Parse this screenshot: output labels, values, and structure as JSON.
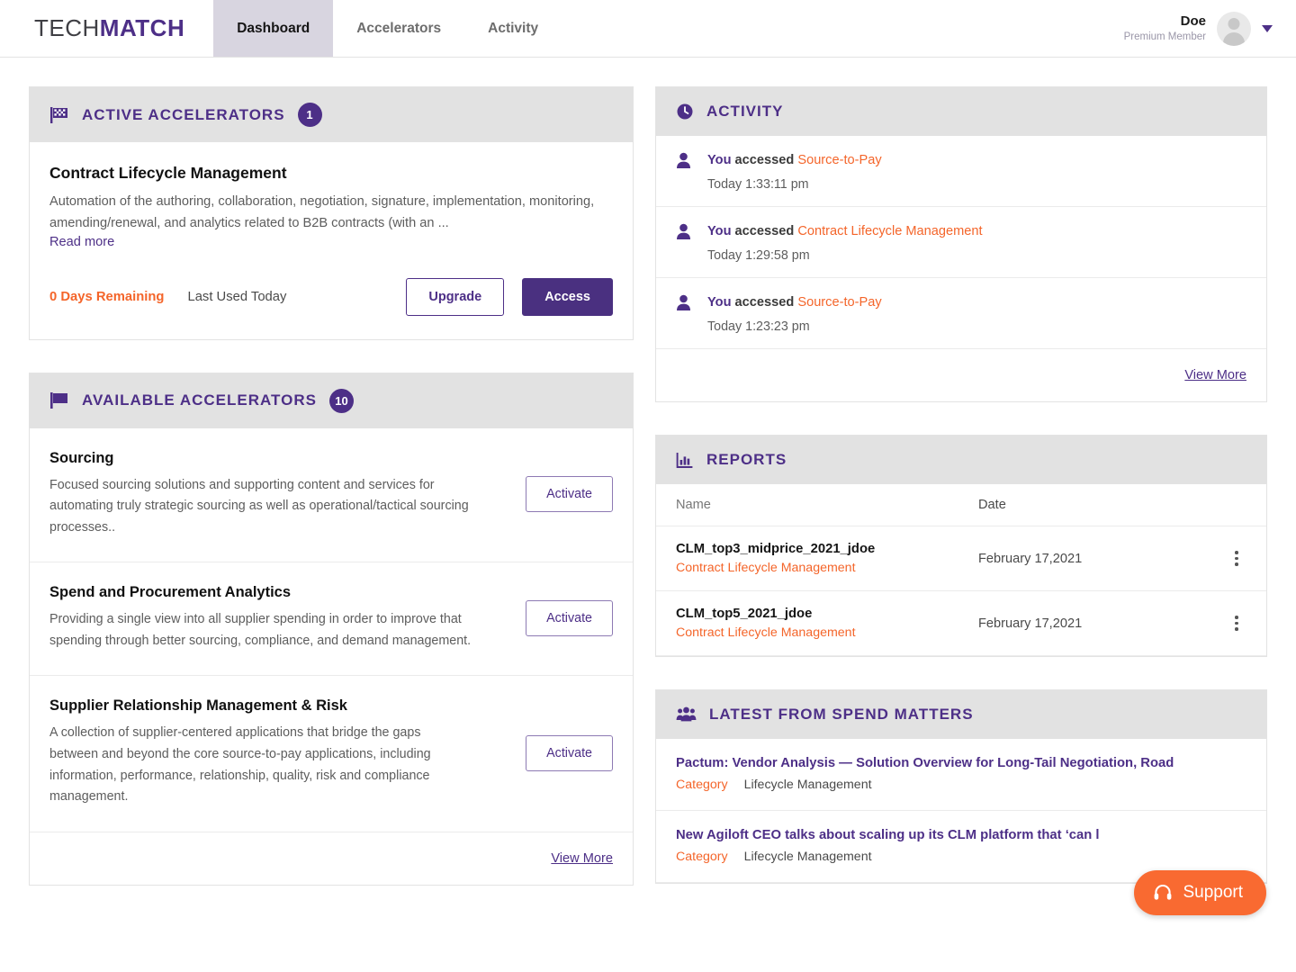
{
  "brand": {
    "part1": "TECH",
    "part2": "MATCH"
  },
  "nav": {
    "tabs": [
      {
        "label": "Dashboard",
        "active": true
      },
      {
        "label": "Accelerators",
        "active": false
      },
      {
        "label": "Activity",
        "active": false
      }
    ]
  },
  "user": {
    "name": "Doe",
    "role": "Premium Member",
    "avatar_icon": "user-avatar-icon"
  },
  "colors": {
    "brand_purple": "#4d2f87",
    "button_purple": "#4a3080",
    "accent_orange": "#f4652a",
    "support_orange": "#f96a31",
    "header_gray": "#e2e2e2"
  },
  "active_accelerators": {
    "title": "ACTIVE ACCELERATORS",
    "icon": "checkered-flag-icon",
    "count": "1",
    "item": {
      "title": "Contract Lifecycle Management",
      "description": "Automation of the authoring, collaboration, negotiation, signature, implementation, monitoring, amending/renewal, and analytics related to B2B contracts (with an ...",
      "read_more": "Read more",
      "days_remaining": "0 Days Remaining",
      "last_used": "Last Used Today",
      "upgrade_label": "Upgrade",
      "access_label": "Access"
    }
  },
  "available_accelerators": {
    "title": "AVAILABLE ACCELERATORS",
    "icon": "flag-icon",
    "count": "10",
    "view_more": "View More",
    "items": [
      {
        "title": "Sourcing",
        "description": "Focused sourcing solutions and supporting content and services for automating truly strategic sourcing as well as operational/tactical sourcing processes..",
        "action": "Activate"
      },
      {
        "title": "Spend and Procurement Analytics",
        "description": "Providing a single view into all supplier spending in order to improve that spending through better sourcing, compliance, and demand management.",
        "action": "Activate"
      },
      {
        "title": "Supplier Relationship Management & Risk",
        "description": "A collection of supplier-centered applications that bridge the gaps between and beyond the core source-to-pay applications, including information, performance, relationship, quality, risk and compliance management.",
        "action": "Activate"
      }
    ]
  },
  "activity": {
    "title": "ACTIVITY",
    "icon": "clock-icon",
    "view_more": "View More",
    "items": [
      {
        "who": "You",
        "verb": "accessed",
        "target": "Source-to-Pay",
        "time": "Today 1:33:11 pm"
      },
      {
        "who": "You",
        "verb": "accessed",
        "target": "Contract Lifecycle Management",
        "time": "Today 1:29:58 pm"
      },
      {
        "who": "You",
        "verb": "accessed",
        "target": "Source-to-Pay",
        "time": "Today 1:23:23 pm"
      }
    ]
  },
  "reports": {
    "title": "REPORTS",
    "icon": "bar-chart-icon",
    "columns": {
      "name": "Name",
      "date": "Date"
    },
    "rows": [
      {
        "name": "CLM_top3_midprice_2021_jdoe",
        "subtitle": "Contract Lifecycle Management",
        "date": "February 17,2021"
      },
      {
        "name": "CLM_top5_2021_jdoe",
        "subtitle": "Contract Lifecycle Management",
        "date": "February 17,2021"
      }
    ]
  },
  "spend_matters": {
    "title": "LATEST FROM SPEND MATTERS",
    "icon": "users-group-icon",
    "items": [
      {
        "title": "Pactum: Vendor Analysis — Solution Overview for Long-Tail Negotiation, Road",
        "category_label": "Category",
        "category_value": "Lifecycle Management"
      },
      {
        "title": "New Agiloft CEO talks about scaling up its CLM platform that ‘can l",
        "category_label": "Category",
        "category_value": "Lifecycle Management"
      }
    ]
  },
  "support": {
    "label": "Support",
    "icon": "headset-icon"
  }
}
